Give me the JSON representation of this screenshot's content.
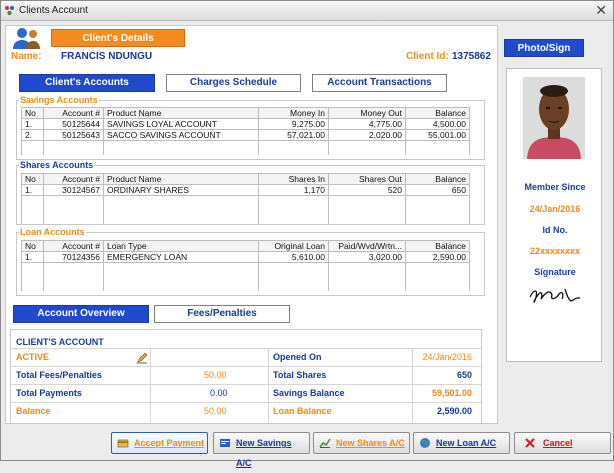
{
  "window": {
    "title": "Clients Account"
  },
  "client": {
    "section_label": "Client's Details",
    "name_label": "Name:",
    "name": "FRANCIS NDUNGU",
    "id_label": "Client Id:",
    "id": "1375862"
  },
  "tabs": {
    "accounts": "Client's Accounts",
    "charges": "Charges Schedule",
    "transactions": "Account Transactions"
  },
  "savings": {
    "title": "Savings Accounts",
    "columns": [
      "No",
      "Account #",
      "Product Name",
      "Money In",
      "Money Out",
      "Balance"
    ],
    "rows": [
      [
        "1.",
        "50125644",
        "SAVINGS LOYAL ACCOUNT",
        "9,275.00",
        "4,775.00",
        "4,500.00"
      ],
      [
        "2.",
        "50125643",
        "SACCO SAVINGS ACCOUNT",
        "57,021.00",
        "2,020.00",
        "55,001.00"
      ]
    ]
  },
  "shares": {
    "title": "Shares Accounts",
    "columns": [
      "No",
      "Account #",
      "Product Name",
      "Shares In",
      "Shares Out",
      "Balance"
    ],
    "rows": [
      [
        "1.",
        "30124567",
        "ORDINARY SHARES",
        "1,170",
        "520",
        "650"
      ]
    ]
  },
  "loans": {
    "title": "Loan Accounts",
    "columns": [
      "No",
      "Account #",
      "Loan Type",
      "Original Loan",
      "Paid/Wvd/Wrtn...",
      "Balance"
    ],
    "rows": [
      [
        "1.",
        "70124356",
        "EMERGENCY LOAN",
        "5,610.00",
        "3,020.00",
        "2,590.00"
      ]
    ]
  },
  "overview_tabs": {
    "overview": "Account Overview",
    "fees": "Fees/Penalties"
  },
  "summary": {
    "heading": "CLIENT'S ACCOUNT",
    "status": "ACTIVE",
    "opened_label": "Opened On",
    "opened_value": "24/Jan/2016",
    "fees_label": "Total Fees/Penalties",
    "fees_value": "50.00",
    "shares_label": "Total Shares",
    "shares_value": "650",
    "payments_label": "Total Payments",
    "payments_value": "0.00",
    "savings_label": "Savings Balance",
    "savings_value": "59,501.00",
    "balance_label": "Balance",
    "balance_value": "50.00",
    "loan_label": "Loan Balance",
    "loan_value": "2,590.00"
  },
  "side": {
    "tab": "Photo/Sign",
    "member_since_label": "Member Since",
    "member_since": "24/Jan/2016",
    "id_label": "Id No.",
    "id_value": "22xxxxxxxx",
    "signature_label": "Signature"
  },
  "buttons": {
    "accept": "Accept Payment",
    "savings": "New Savings A/C",
    "shares": "New Shares A/C",
    "loan": "New Loan A/C",
    "cancel": "Cancel"
  },
  "colors": {
    "orange": "#f58a1f",
    "blue": "#2049cc",
    "navy": "#17379a"
  }
}
